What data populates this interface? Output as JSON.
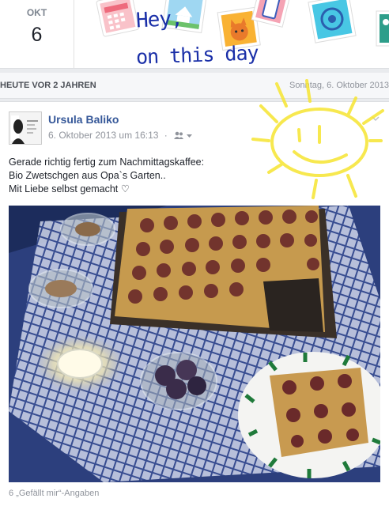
{
  "header": {
    "month": "OKT",
    "day": "6",
    "greeting_line1": "Hey,",
    "greeting_line2": "on this day"
  },
  "subheader": {
    "years_ago": "HEUTE VOR 2 JAHREN",
    "date": "Sonntag, 6. Oktober 2013"
  },
  "post": {
    "author": "Ursula Baliko",
    "timestamp": "6. Oktober 2013 um 16:13",
    "separator": "·",
    "audience_icon": "friends-icon",
    "text_lines": [
      "Gerade richtig fertig zum Nachmittagskaffee:",
      "Bio Zwetschgen aus Opa`s Garten..",
      "Mit Liebe selbst gemacht ♡"
    ],
    "likes": "6 „Gefällt mir“-Angaben"
  },
  "colors": {
    "link": "#365899",
    "handwriting": "#1a2fa8",
    "sun": "#f6e531"
  }
}
